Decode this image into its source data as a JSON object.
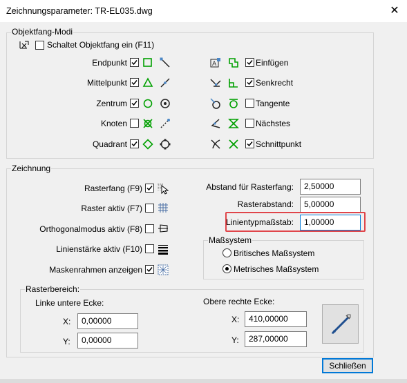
{
  "window": {
    "title": "Zeichnungsparameter: TR-EL035.dwg"
  },
  "snap": {
    "group_label": "Objektfang-Modi",
    "master": {
      "label": "Schaltet Objektfang ein (F11)",
      "checked": false
    },
    "left": [
      {
        "label": "Endpunkt",
        "checked": true
      },
      {
        "label": "Mittelpunkt",
        "checked": true
      },
      {
        "label": "Zentrum",
        "checked": true
      },
      {
        "label": "Knoten",
        "checked": false
      },
      {
        "label": "Quadrant",
        "checked": true
      }
    ],
    "right": [
      {
        "label": "Einfügen",
        "checked": true
      },
      {
        "label": "Senkrecht",
        "checked": true
      },
      {
        "label": "Tangente",
        "checked": false
      },
      {
        "label": "Nächstes",
        "checked": false
      },
      {
        "label": "Schnittpunkt",
        "checked": true
      }
    ]
  },
  "drawing": {
    "group_label": "Zeichnung",
    "options": [
      {
        "label": "Rasterfang (F9)",
        "checked": true
      },
      {
        "label": "Raster aktiv (F7)",
        "checked": false
      },
      {
        "label": "Orthogonalmodus aktiv (F8)",
        "checked": false
      },
      {
        "label": "Linienstärke aktiv (F10)",
        "checked": false
      },
      {
        "label": "Maskenrahmen anzeigen",
        "checked": true
      }
    ],
    "snap_spacing_label": "Abstand für Rasterfang:",
    "snap_spacing_value": "2,50000",
    "grid_spacing_label": "Rasterabstand:",
    "grid_spacing_value": "5,00000",
    "linetype_scale_label": "Linientypmaßstab:",
    "linetype_scale_value": "1,00000",
    "units": {
      "group_label": "Maßsystem",
      "options": [
        {
          "label": "Britisches Maßsystem",
          "selected": false
        },
        {
          "label": "Metrisches Maßsystem",
          "selected": true
        }
      ]
    },
    "limits": {
      "group_label": "Rasterbereich:",
      "lower_left_label": "Linke untere Ecke:",
      "upper_right_label": "Obere rechte Ecke:",
      "x_label": "X:",
      "y_label": "Y:",
      "lower_x": "0,00000",
      "lower_y": "0,00000",
      "upper_x": "410,00000",
      "upper_y": "287,00000"
    }
  },
  "buttons": {
    "close_label": "Schließen"
  },
  "colors": {
    "snap_marker": "#00a000",
    "highlight": "#e0454a",
    "default_button": "#0078d7"
  }
}
